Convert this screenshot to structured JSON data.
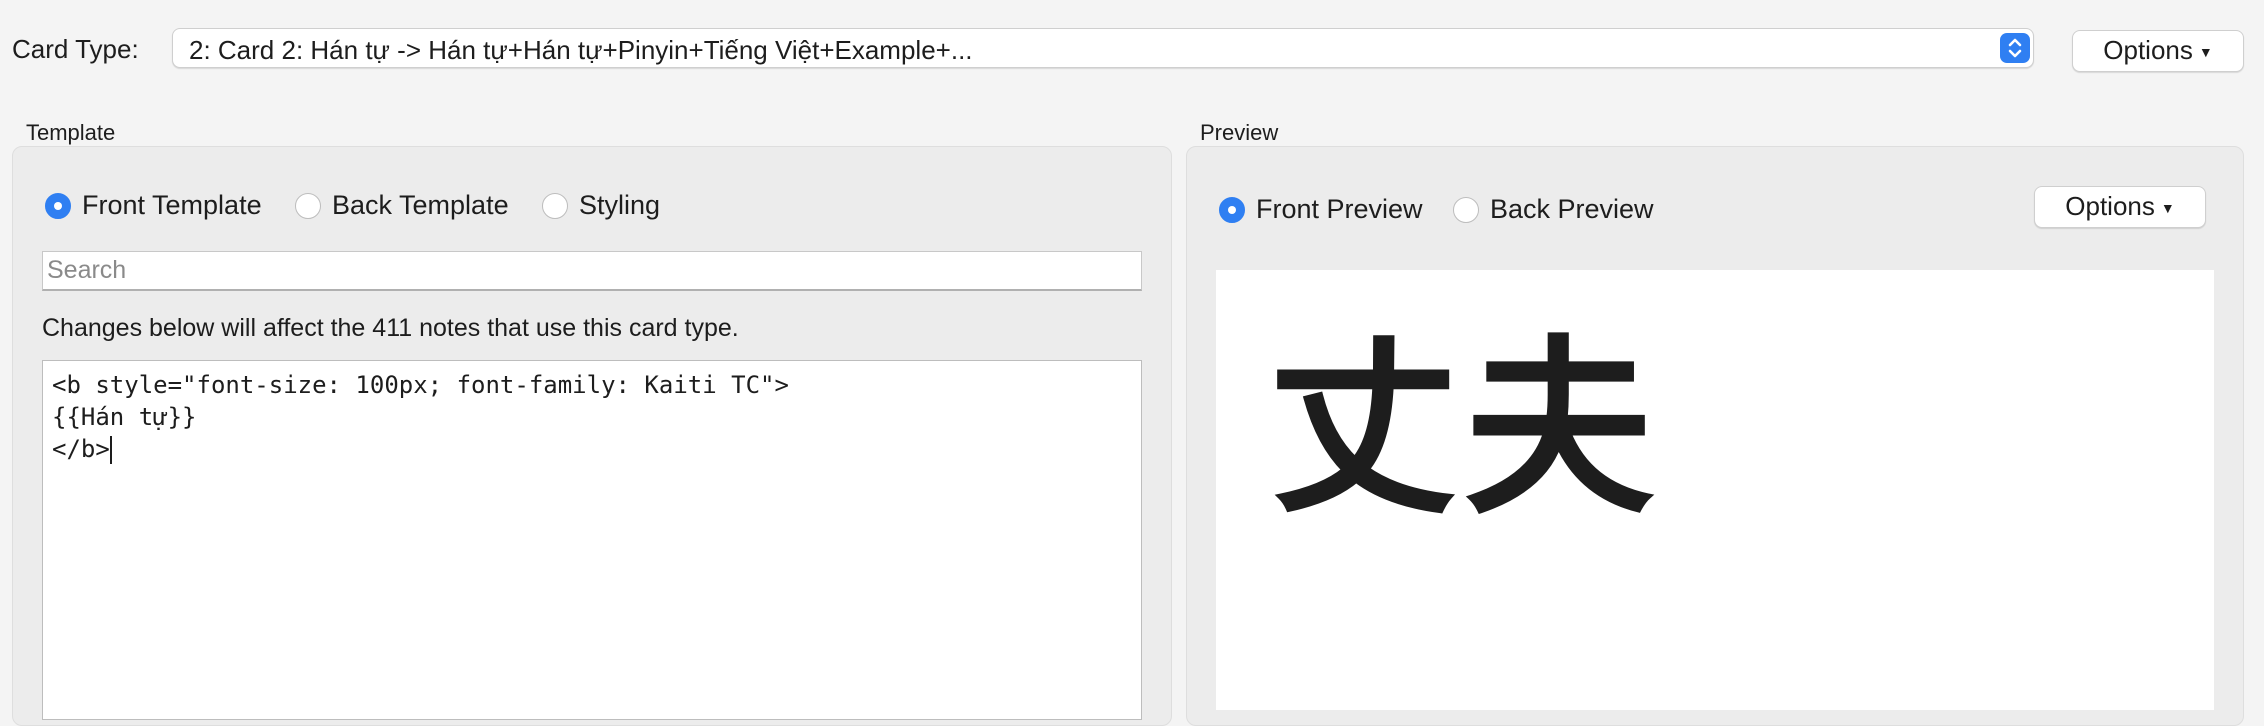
{
  "card_type": {
    "label": "Card Type:",
    "selected": "2: Card 2: Hán tự -> Hán tự+Hán tự+Pinyin+Tiếng Việt+Example+..."
  },
  "options_top": {
    "label": "Options",
    "arrow": "▼"
  },
  "template": {
    "group_label": "Template",
    "radios": {
      "front": "Front Template",
      "back": "Back Template",
      "styling": "Styling"
    },
    "selected": "front",
    "search_placeholder": "Search",
    "changes_text": "Changes below will affect the 411 notes that use this card type.",
    "editor_lines": [
      "<b style=\"font-size: 100px; font-family: Kaiti TC\">",
      "{{Hán tự}}",
      "</b>"
    ]
  },
  "preview": {
    "group_label": "Preview",
    "radios": {
      "front": "Front Preview",
      "back": "Back Preview"
    },
    "selected": "front",
    "options_label": "Options",
    "options_arrow": "▼",
    "content": "丈夫"
  },
  "colors": {
    "accent": "#2f7ff2"
  },
  "icons": {
    "select_stepper": "up-down-chevron-icon",
    "radio": "radio-dot-icon"
  }
}
